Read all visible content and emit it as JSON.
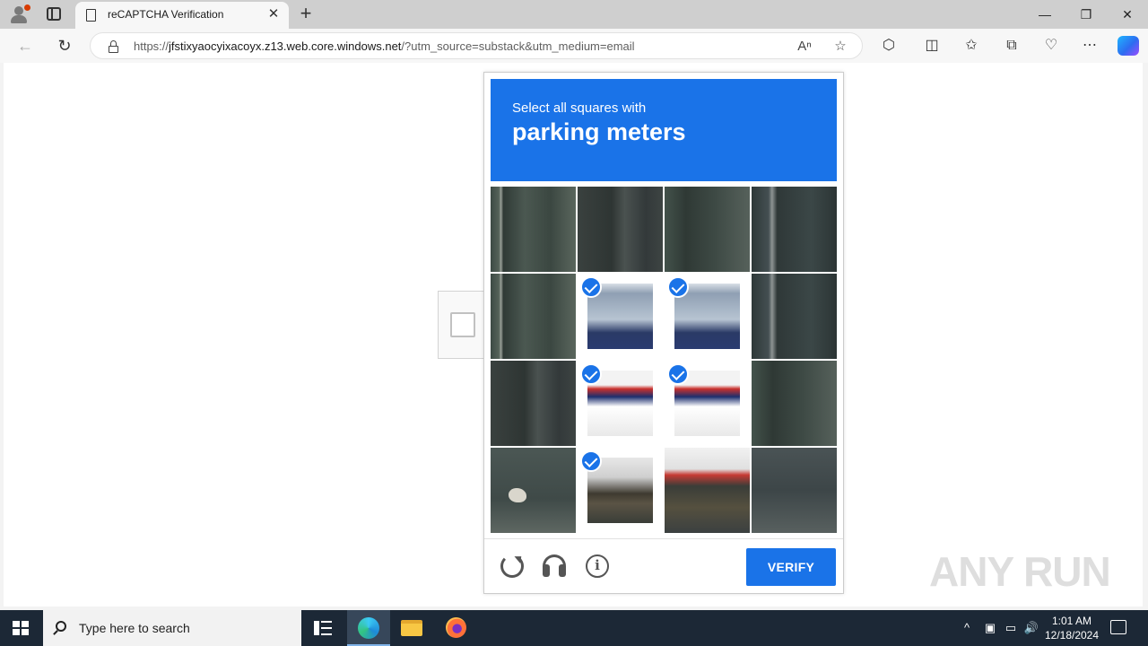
{
  "browser": {
    "tab": {
      "title": "reCAPTCHA Verification",
      "close_glyph": "✕"
    },
    "new_tab_glyph": "+",
    "window_controls": {
      "minimize": "—",
      "maximize": "❐",
      "close": "✕"
    },
    "nav": {
      "back_glyph": "←",
      "refresh_glyph": "↻"
    },
    "address": {
      "scheme": "https://",
      "host": "jfstixyaocyixacoyx.z13.web.core.windows.net",
      "path": "/?utm_source=substack&utm_medium=email"
    },
    "address_icons": {
      "read_aloud": "Aⁿ",
      "favorite": "☆"
    },
    "toolbar_icons": {
      "extensions": "⬡",
      "split": "◫",
      "favorites": "✩",
      "collections": "⧉",
      "performance": "♡",
      "more": "⋯"
    }
  },
  "captcha": {
    "header": {
      "instruction": "Select all squares with",
      "target": "parking meters"
    },
    "grid": {
      "rows": 4,
      "cols": 4,
      "tiles": [
        {
          "selected": false,
          "texture": "p-door"
        },
        {
          "selected": false,
          "texture": "p-door2"
        },
        {
          "selected": false,
          "texture": "p-door3"
        },
        {
          "selected": false,
          "texture": "p-door4"
        },
        {
          "selected": false,
          "texture": "p-door"
        },
        {
          "selected": true,
          "texture": "p-meter-win"
        },
        {
          "selected": true,
          "texture": "p-meter-win"
        },
        {
          "selected": false,
          "texture": "p-door4"
        },
        {
          "selected": false,
          "texture": "p-door2"
        },
        {
          "selected": true,
          "texture": "p-meter-mid"
        },
        {
          "selected": true,
          "texture": "p-meter-mid"
        },
        {
          "selected": false,
          "texture": "p-door3"
        },
        {
          "selected": false,
          "texture": "p-ground"
        },
        {
          "selected": true,
          "texture": "p-post"
        },
        {
          "selected": false,
          "texture": "p-post2"
        },
        {
          "selected": false,
          "texture": "p-ground2"
        }
      ]
    },
    "verify_label": "VERIFY",
    "accent_color": "#1a73e8"
  },
  "watermark": "ANY RUN",
  "taskbar": {
    "search_placeholder": "Type here to search",
    "clock": {
      "time": "1:01 AM",
      "date": "12/18/2024"
    },
    "tray": {
      "chevron": "^",
      "volume": "🔊"
    }
  }
}
